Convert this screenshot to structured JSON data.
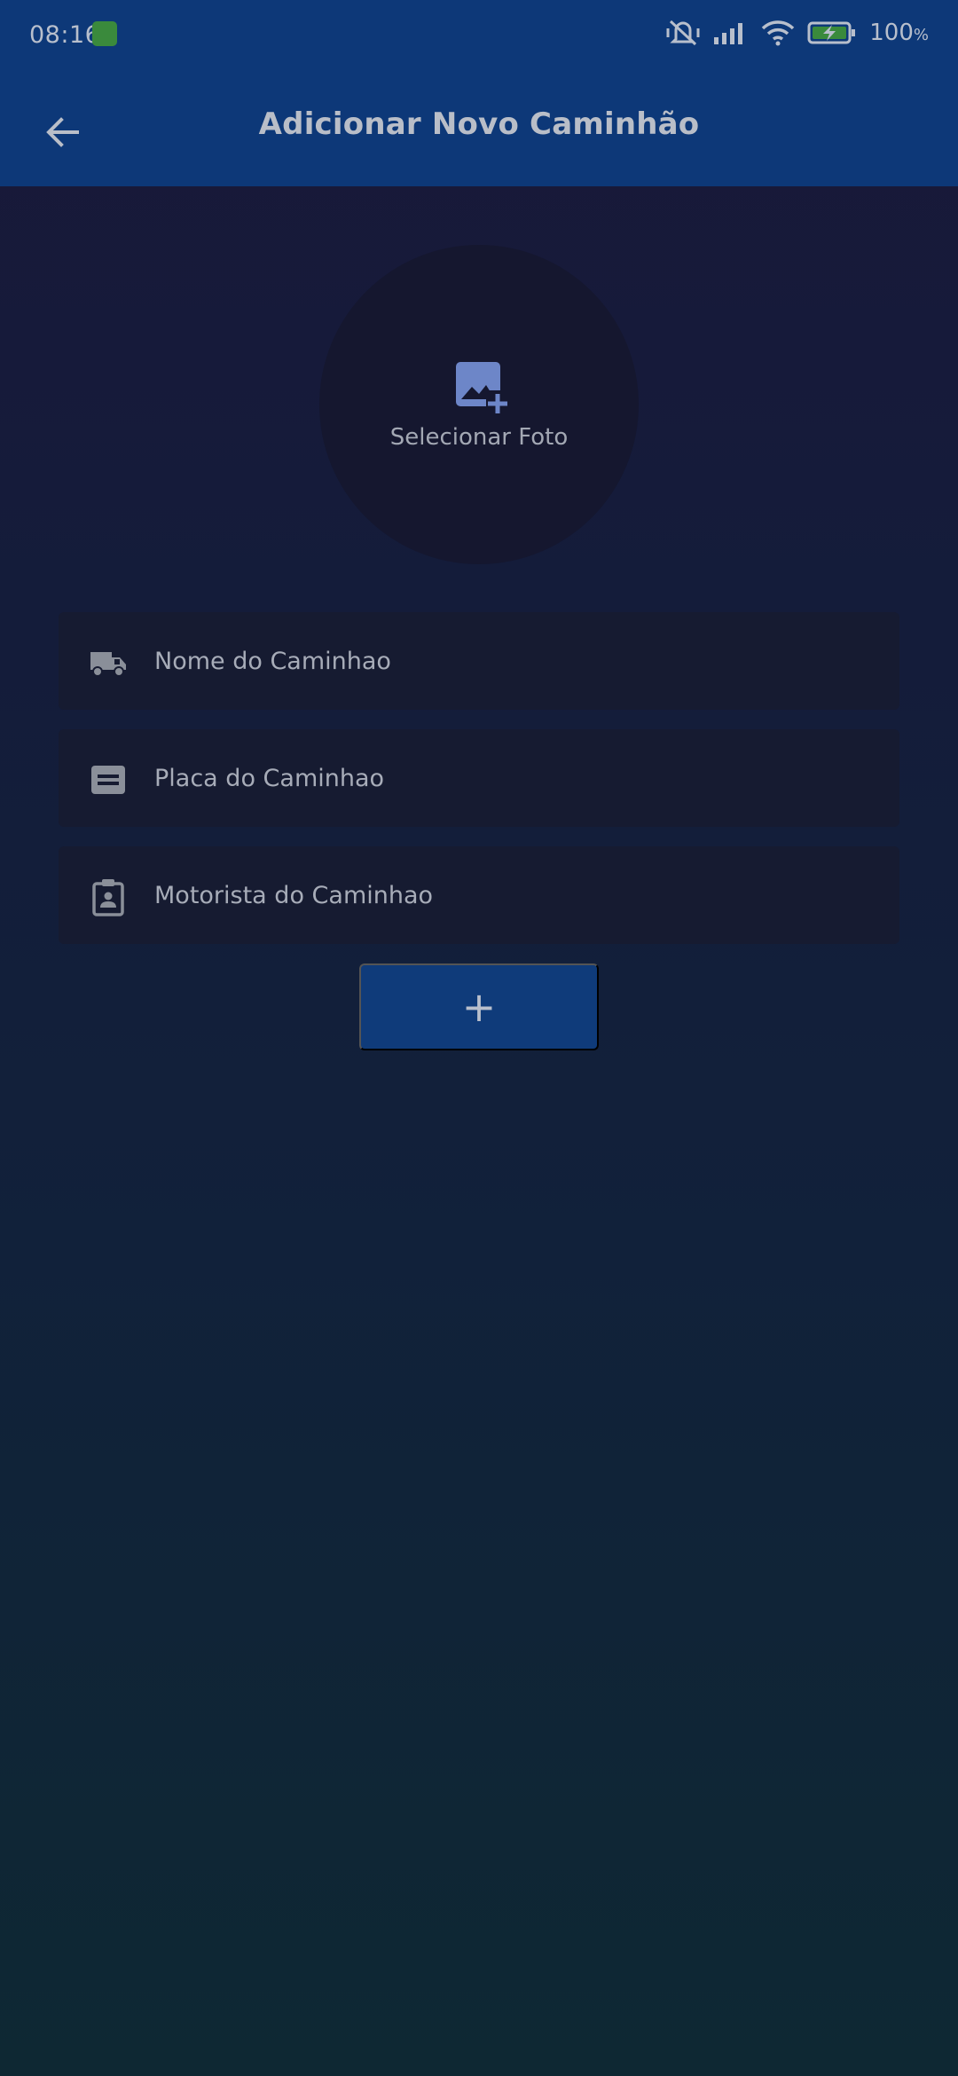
{
  "status_bar": {
    "time": "08:16",
    "battery_percent": "100",
    "battery_unit": "%",
    "icons": [
      "app-notification-icon",
      "mute-vibrate-icon",
      "signal-icon",
      "wifi-icon",
      "battery-charging-icon"
    ]
  },
  "app_bar": {
    "title": "Adicionar Novo Caminhão",
    "back_icon": "arrow-back-icon"
  },
  "photo_picker": {
    "label": "Selecionar Foto",
    "icon": "add-photo-icon"
  },
  "form": {
    "fields": [
      {
        "placeholder": "Nome do Caminhao",
        "value": "",
        "icon": "truck-icon"
      },
      {
        "placeholder": "Placa do Caminhao",
        "value": "",
        "icon": "plate-icon"
      },
      {
        "placeholder": "Motorista do Caminhao",
        "value": "",
        "icon": "driver-badge-icon"
      }
    ],
    "submit_label": "+"
  },
  "colors": {
    "app_bar": "#0d3878",
    "background_top": "#191839",
    "background_bottom": "#0e2833",
    "field_background": "#161b31",
    "button_background": "#0f3b7a",
    "photo_icon": "#6d86c8"
  }
}
